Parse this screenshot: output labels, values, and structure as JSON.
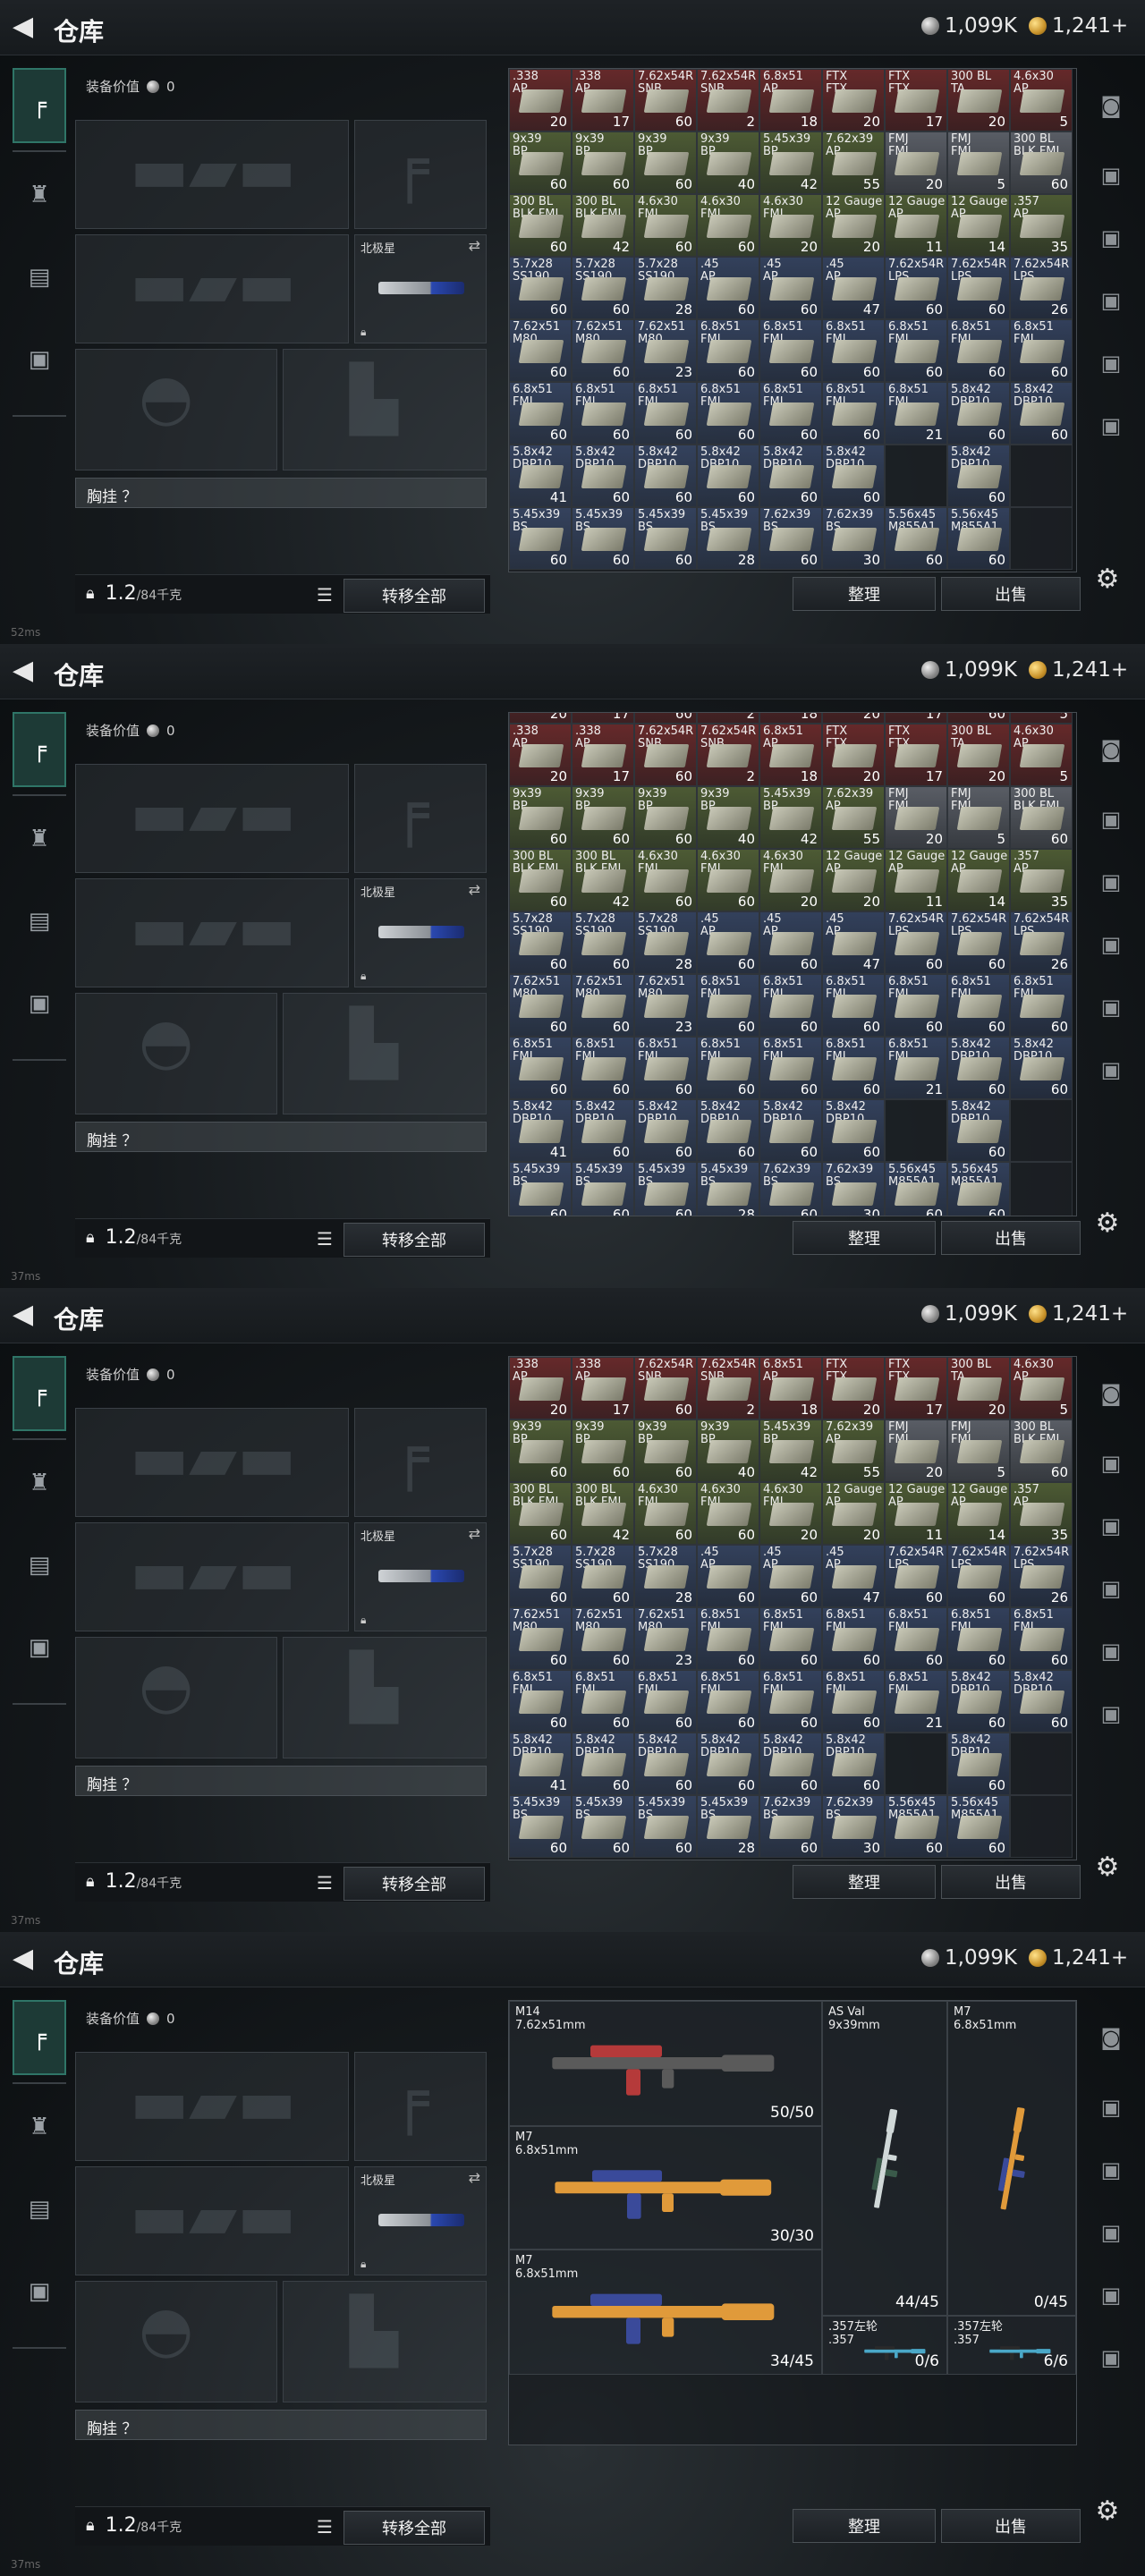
{
  "title": "仓库",
  "currency": {
    "silver": "1,099K",
    "gold": "1,241+"
  },
  "equipment": {
    "value_label": "装备价值",
    "value": "0",
    "slot_name": "北极星",
    "chest_label": "胸挂 ？",
    "weight": "1.2",
    "weight_max": "/84千克",
    "transfer_all": "转移全部"
  },
  "actions": {
    "sort": "整理",
    "sell": "出售"
  },
  "ammo_page_1": [
    [
      ".338\nAP",
      "20",
      "#7a2e2e"
    ],
    [
      ".338\nAP",
      "17",
      "#7a2e2e"
    ],
    [
      "7.62x54R\nSNB",
      "60",
      "#7a2e2e"
    ],
    [
      "7.62x54R\nSNB",
      "2",
      "#7a2e2e"
    ],
    [
      "6.8x51\nAP",
      "18",
      "#7a2e2e"
    ],
    [
      "FTX\nFTX",
      "20",
      "#7a2e2e"
    ],
    [
      "FTX\nFTX",
      "17",
      "#7a2e2e"
    ],
    [
      "300 BL\nTA",
      "20",
      "#7a2e2e"
    ],
    [
      "4.6x30\nAP",
      "5",
      "#7a2e2e"
    ],
    [
      "9x39\nBP",
      "60",
      "#5b6b3a"
    ],
    [
      "9x39\nBP",
      "60",
      "#5b6b3a"
    ],
    [
      "9x39\nBP",
      "60",
      "#5b6b3a"
    ],
    [
      "9x39\nBP",
      "40",
      "#5b6b3a"
    ],
    [
      "5.45x39\nBP",
      "42",
      "#5b6b3a"
    ],
    [
      "7.62x39\nAP",
      "55",
      "#5b6b3a"
    ],
    [
      "FMJ\nFMJ",
      "20",
      "#6b6f78"
    ],
    [
      "FMJ\nFMJ",
      "5",
      "#6b6f78"
    ],
    [
      "300 BL\nBLK FMJ",
      "60",
      "#6b6f78"
    ],
    [
      "300 BL\nBLK FMJ",
      "60",
      "#5b6b3a"
    ],
    [
      "300 BL\nBLK FMJ",
      "42",
      "#5b6b3a"
    ],
    [
      "4.6x30\nFMJ",
      "60",
      "#5b6b3a"
    ],
    [
      "4.6x30\nFMJ",
      "60",
      "#5b6b3a"
    ],
    [
      "4.6x30\nFMJ",
      "20",
      "#5b6b3a"
    ],
    [
      "12 Gauge\nAP",
      "20",
      "#5b6b3a"
    ],
    [
      "12 Gauge\nAP",
      "11",
      "#5b6b3a"
    ],
    [
      "12 Gauge\nAP",
      "14",
      "#5b6b3a"
    ],
    [
      ".357\nAP",
      "35",
      "#5b6b3a"
    ],
    [
      "5.7x28\nSS190",
      "60",
      "#3a4a6b"
    ],
    [
      "5.7x28\nSS190",
      "60",
      "#3a4a6b"
    ],
    [
      "5.7x28\nSS190",
      "28",
      "#3a4a6b"
    ],
    [
      ".45\nAP",
      "60",
      "#3a4a6b"
    ],
    [
      ".45\nAP",
      "60",
      "#3a4a6b"
    ],
    [
      ".45\nAP",
      "47",
      "#3a4a6b"
    ],
    [
      "7.62x54R\nLPS",
      "60",
      "#3a4a6b"
    ],
    [
      "7.62x54R\nLPS",
      "60",
      "#3a4a6b"
    ],
    [
      "7.62x54R\nLPS",
      "26",
      "#3a4a6b"
    ],
    [
      "7.62x51\nM80",
      "60",
      "#3a4a6b"
    ],
    [
      "7.62x51\nM80",
      "60",
      "#3a4a6b"
    ],
    [
      "7.62x51\nM80",
      "23",
      "#3a4a6b"
    ],
    [
      "6.8x51\nFMJ",
      "60",
      "#3a4a6b"
    ],
    [
      "6.8x51\nFMJ",
      "60",
      "#3a4a6b"
    ],
    [
      "6.8x51\nFMJ",
      "60",
      "#3a4a6b"
    ],
    [
      "6.8x51\nFMJ",
      "60",
      "#3a4a6b"
    ],
    [
      "6.8x51\nFMJ",
      "60",
      "#3a4a6b"
    ],
    [
      "6.8x51\nFMJ",
      "60",
      "#3a4a6b"
    ],
    [
      "6.8x51\nFMJ",
      "60",
      "#3a4a6b"
    ],
    [
      "6.8x51\nFMJ",
      "60",
      "#3a4a6b"
    ],
    [
      "6.8x51\nFMJ",
      "60",
      "#3a4a6b"
    ],
    [
      "6.8x51\nFMJ",
      "60",
      "#3a4a6b"
    ],
    [
      "6.8x51\nFMJ",
      "60",
      "#3a4a6b"
    ],
    [
      "6.8x51\nFMJ",
      "60",
      "#3a4a6b"
    ],
    [
      "6.8x51\nFMJ",
      "21",
      "#3a4a6b"
    ],
    [
      "5.8x42\nDBP10",
      "60",
      "#3a4a6b"
    ],
    [
      "5.8x42\nDBP10",
      "60",
      "#3a4a6b"
    ],
    [
      "5.8x42\nDBP10",
      "41",
      "#3a4a6b"
    ],
    [
      "5.8x42\nDBP10",
      "60",
      "#3a4a6b"
    ],
    [
      "5.8x42\nDBP10",
      "60",
      "#3a4a6b"
    ],
    [
      "5.8x42\nDBP10",
      "60",
      "#3a4a6b"
    ],
    [
      "5.8x42\nDBP10",
      "60",
      "#3a4a6b"
    ],
    [
      "5.8x42\nDBP10",
      "60",
      "#3a4a6b"
    ],
    [
      "",
      "",
      ""
    ],
    [
      "5.8x42\nDBP10",
      "60",
      "#3a4a6b"
    ],
    [
      "",
      "",
      ""
    ],
    [
      "5.45x39\nBS",
      "60",
      "#3a4a6b"
    ],
    [
      "5.45x39\nBS",
      "60",
      "#3a4a6b"
    ],
    [
      "5.45x39\nBS",
      "60",
      "#3a4a6b"
    ],
    [
      "5.45x39\nBS",
      "28",
      "#3a4a6b"
    ],
    [
      "7.62x39\nBS",
      "60",
      "#3a4a6b"
    ],
    [
      "7.62x39\nBS",
      "30",
      "#3a4a6b"
    ],
    [
      "5.56x45\nM855A1",
      "60",
      "#3a4a6b"
    ],
    [
      "5.56x45\nM855A1",
      "60",
      "#3a4a6b"
    ],
    [
      "",
      "",
      ""
    ]
  ],
  "ammo_page_2_top": [
    "20",
    "17",
    "60",
    "2",
    "18",
    "20",
    "17",
    "60",
    "5"
  ],
  "weapons": [
    {
      "name": "M14",
      "caliber": "7.62x51mm",
      "count": "50/50"
    },
    {
      "name": "M7",
      "caliber": "6.8x51mm",
      "count": "30/30"
    },
    {
      "name": "M7",
      "caliber": "6.8x51mm",
      "count": "34/45"
    },
    {
      "name": "AS Val",
      "caliber": "9x39mm",
      "count": "44/45"
    },
    {
      "name": "M7",
      "caliber": "6.8x51mm",
      "count": "0/45"
    },
    {
      "name": ".357左轮",
      "caliber": ".357",
      "count": "0/6"
    },
    {
      "name": ".357左轮",
      "caliber": ".357",
      "count": "6/6"
    }
  ],
  "status": [
    "52ms",
    "37ms",
    "37ms",
    "37ms"
  ],
  "colors": {
    "accent": "#2f7567",
    "panel": "#15191c"
  }
}
